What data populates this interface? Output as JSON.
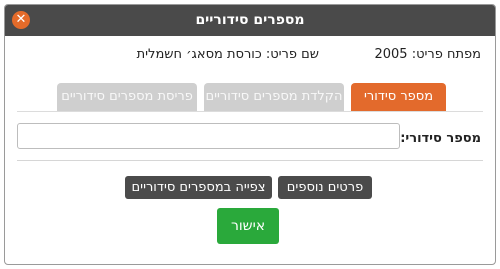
{
  "window": {
    "title": "מספרים סידוריים",
    "close_icon": "close-icon"
  },
  "item": {
    "key_label": "מפתח פריט:",
    "key_value": "2005",
    "name_label": "שם פריט:",
    "name_value": "כורסת מסאג׳ חשמלית"
  },
  "tabs": [
    {
      "label": "מספר סידורי",
      "active": true
    },
    {
      "label": "הקלדת מספרים סידוריים",
      "active": false
    },
    {
      "label": "פריסת מספרים סידוריים",
      "active": false
    }
  ],
  "serial": {
    "label": "מספר סידורי:",
    "value": "",
    "placeholder": ""
  },
  "buttons": {
    "more_details": "פרטים נוספים",
    "view_serials": "צפייה במספרים סידוריים",
    "confirm": "אישור"
  },
  "colors": {
    "titlebar": "#4a4a4a",
    "accent": "#e36a2c",
    "ok": "#2aa93b"
  }
}
